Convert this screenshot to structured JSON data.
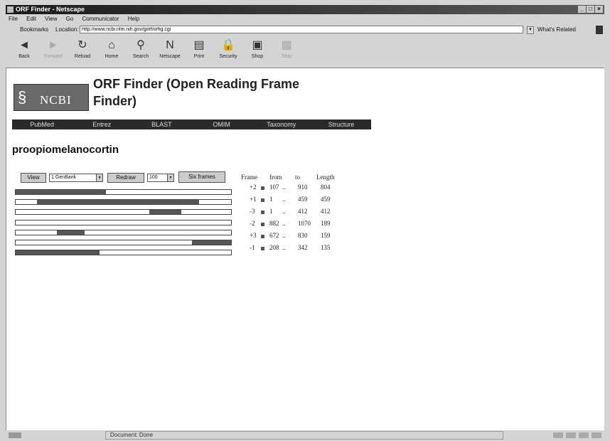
{
  "window": {
    "title": "ORF Finder - Netscape",
    "controls": [
      "_",
      "□",
      "×"
    ]
  },
  "menu": [
    "File",
    "Edit",
    "View",
    "Go",
    "Communicator",
    "Help"
  ],
  "location_bar": {
    "bookmarks_label": "Bookmarks",
    "location_label": "Location:",
    "url": "http://www.ncbi.nlm.nih.gov/gorf/orfig.cgi",
    "related_label": "What's Related"
  },
  "toolbar": [
    {
      "label": "Back",
      "icon": "back-arrow-icon",
      "glyph": "◄",
      "enabled": true
    },
    {
      "label": "Forward",
      "icon": "forward-arrow-icon",
      "glyph": "►",
      "enabled": false
    },
    {
      "label": "Reload",
      "icon": "reload-icon",
      "glyph": "↻",
      "enabled": true
    },
    {
      "label": "Home",
      "icon": "home-icon",
      "glyph": "⌂",
      "enabled": true
    },
    {
      "label": "Search",
      "icon": "search-icon",
      "glyph": "⚲",
      "enabled": true
    },
    {
      "label": "Netscape",
      "icon": "netscape-icon",
      "glyph": "N",
      "enabled": true
    },
    {
      "label": "Print",
      "icon": "print-icon",
      "glyph": "▤",
      "enabled": true
    },
    {
      "label": "Security",
      "icon": "lock-icon",
      "glyph": "🔒",
      "enabled": true
    },
    {
      "label": "Shop",
      "icon": "shop-icon",
      "glyph": "▣",
      "enabled": true
    },
    {
      "label": "Stop",
      "icon": "stop-icon",
      "glyph": "▩",
      "enabled": false
    }
  ],
  "page": {
    "logo_text": "NCBI",
    "title": "ORF Finder (Open Reading Frame Finder)",
    "nav": [
      "PubMed",
      "Entrez",
      "BLAST",
      "OMIM",
      "Taxonomy",
      "Structure"
    ],
    "heading": "proopiomelanocortin"
  },
  "controls": {
    "view_button": "View",
    "format_select": "1 GenBank",
    "redraw_button": "Redraw",
    "size_select": "100",
    "frames_button": "Six frames"
  },
  "orf_table": {
    "headers": [
      "Frame",
      "from",
      "to",
      "Length"
    ],
    "rows": [
      {
        "frame": "+2",
        "from": "107",
        "to": "910",
        "length": "804"
      },
      {
        "frame": "+1",
        "from": "1",
        "to": "459",
        "length": "459"
      },
      {
        "frame": "-3",
        "from": "1",
        "to": "412",
        "length": "412"
      },
      {
        "frame": "-2",
        "from": "882",
        "to": "1070",
        "length": "189"
      },
      {
        "frame": "+3",
        "from": "672",
        "to": "830",
        "length": "159"
      },
      {
        "frame": "-1",
        "from": "208",
        "to": "342",
        "length": "135"
      }
    ]
  },
  "orf_tracks": [
    {
      "start": 0.0,
      "end": 0.42
    },
    {
      "start": 0.1,
      "end": 0.85
    },
    {
      "start": 0.62,
      "end": 0.77
    },
    {
      "start": 0.0,
      "end": 0.0
    },
    {
      "start": 0.19,
      "end": 0.32
    },
    {
      "start": 0.82,
      "end": 1.0
    },
    {
      "start": 0.0,
      "end": 0.39
    }
  ],
  "status": {
    "text": "Document: Done"
  }
}
